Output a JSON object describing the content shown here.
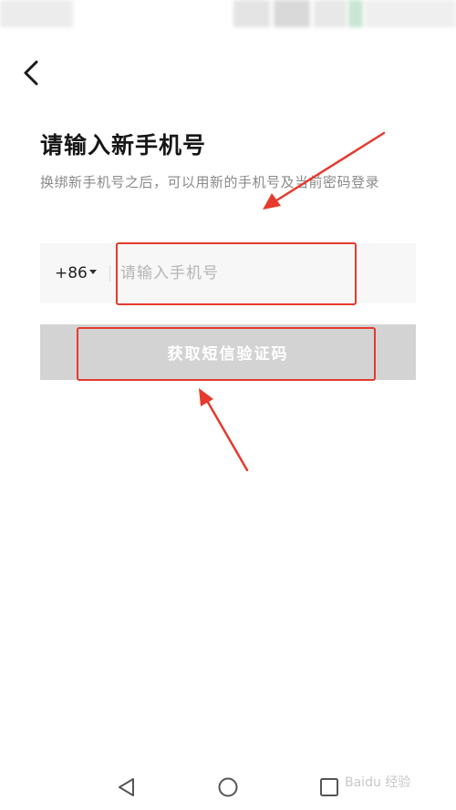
{
  "header": {
    "back_icon": "chevron-left-icon"
  },
  "page": {
    "title": "请输入新手机号",
    "description": "换绑新手机号之后，可以用新的手机号及当前密码登录"
  },
  "phone_form": {
    "country_code": "+86",
    "phone_placeholder": "请输入手机号",
    "phone_value": "",
    "submit_label": "获取短信验证码"
  },
  "colors": {
    "title": "#161616",
    "description": "#8a8a8a",
    "input_background": "#f7f7f7",
    "button_disabled": "#d3d3d3",
    "annotation": "#e53a2e"
  },
  "nav": {
    "back_icon": "triangle-back-icon",
    "home_icon": "circle-home-icon",
    "recents_icon": "square-recents-icon"
  },
  "watermark": {
    "text": "Baidu 经验"
  }
}
